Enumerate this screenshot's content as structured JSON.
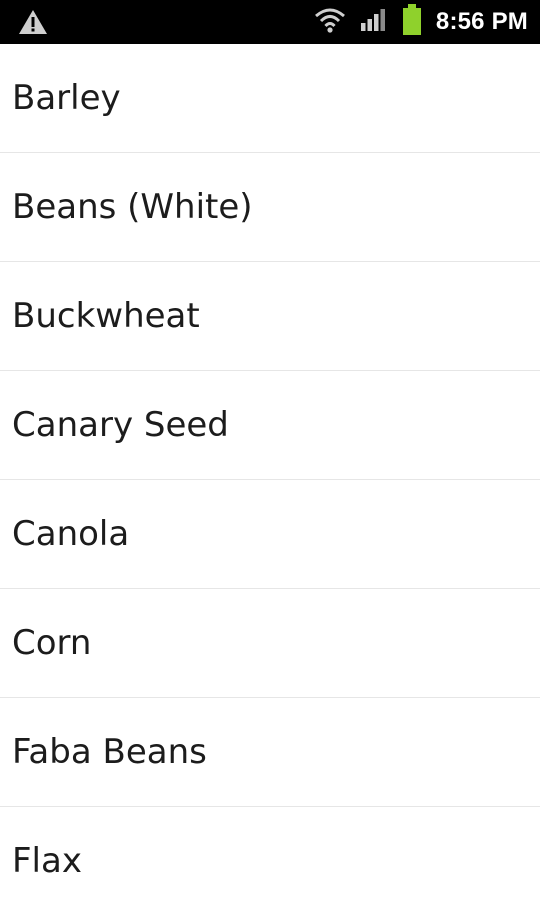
{
  "status_bar": {
    "time": "8:56 PM",
    "icons": [
      "warning-icon",
      "wifi-icon",
      "signal-icon",
      "battery-icon"
    ],
    "colors": {
      "background": "#000000",
      "icon": "#cfcfcf",
      "battery": "#8fd12c"
    }
  },
  "list": {
    "items": [
      {
        "label": "Barley"
      },
      {
        "label": "Beans (White)"
      },
      {
        "label": "Buckwheat"
      },
      {
        "label": "Canary Seed"
      },
      {
        "label": "Canola"
      },
      {
        "label": "Corn"
      },
      {
        "label": "Faba Beans"
      },
      {
        "label": "Flax"
      }
    ]
  }
}
